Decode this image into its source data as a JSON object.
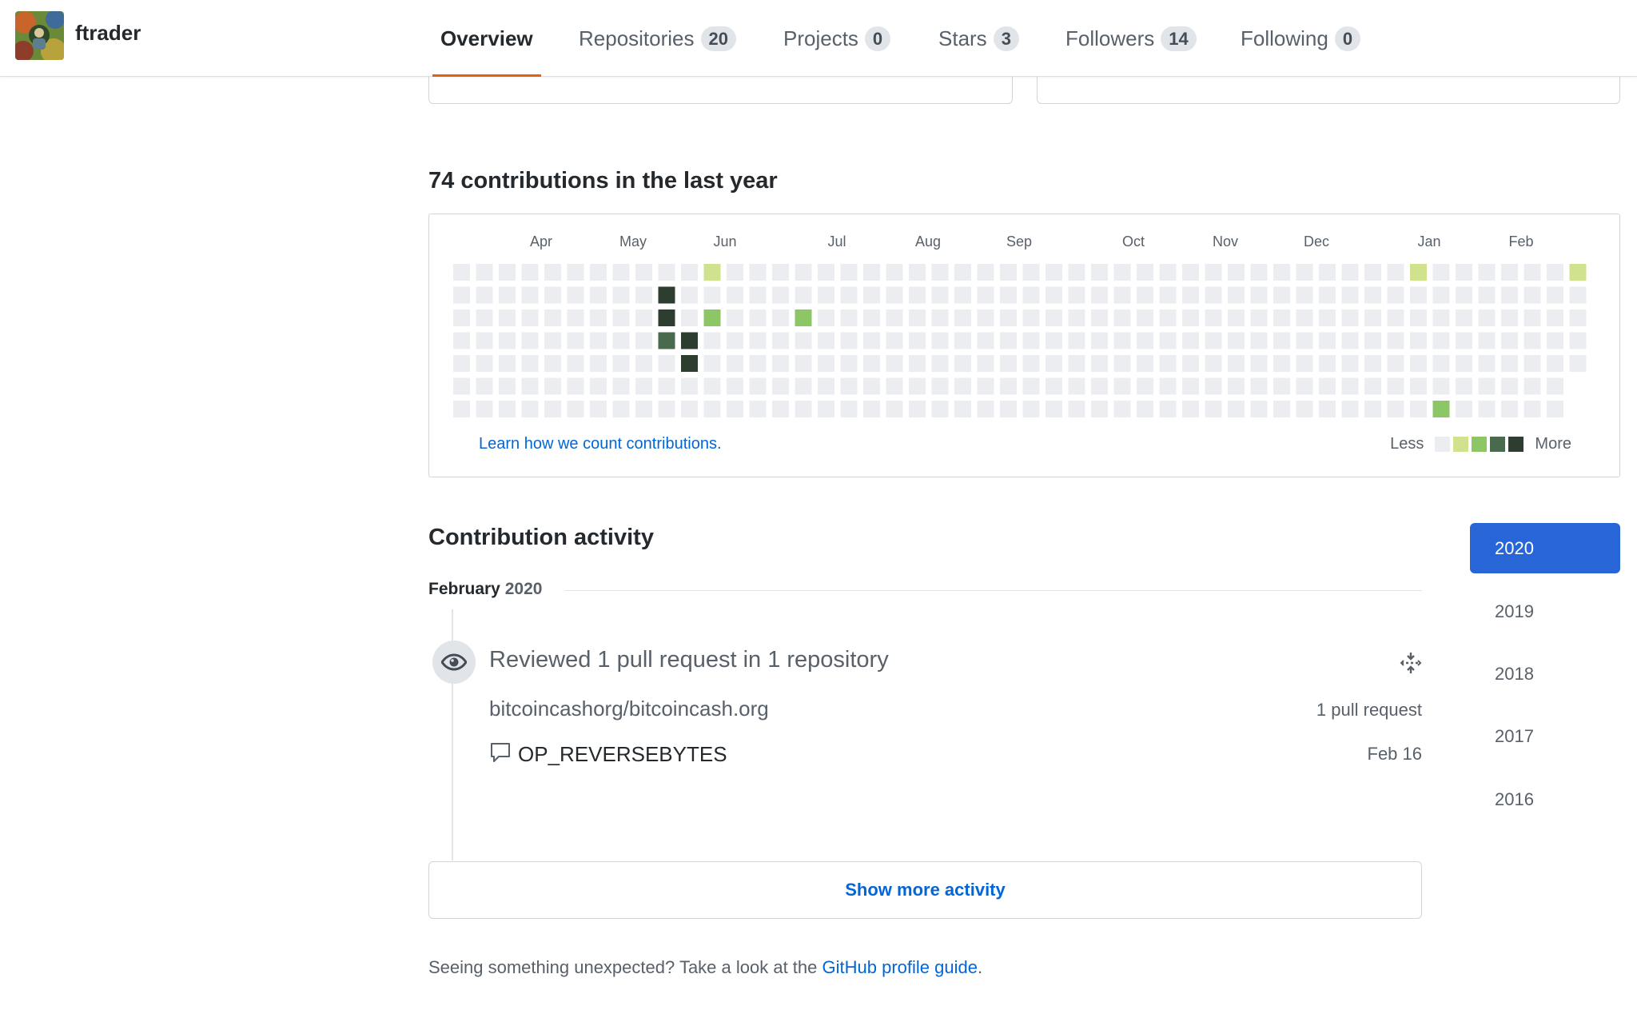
{
  "header": {
    "username": "ftrader",
    "tabs": [
      {
        "label": "Overview",
        "count": null,
        "active": true
      },
      {
        "label": "Repositories",
        "count": "20"
      },
      {
        "label": "Projects",
        "count": "0"
      },
      {
        "label": "Stars",
        "count": "3"
      },
      {
        "label": "Followers",
        "count": "14"
      },
      {
        "label": "Following",
        "count": "0"
      }
    ]
  },
  "contributions": {
    "heading": "74 contributions in the last year",
    "months": [
      "Apr",
      "May",
      "Jun",
      "Jul",
      "Aug",
      "Sep",
      "Oct",
      "Nov",
      "Dec",
      "Jan",
      "Feb"
    ],
    "learn_link": "Learn how we count contributions.",
    "legend_less": "Less",
    "legend_more": "More",
    "colors": {
      "level0": "#ebedf0",
      "level1": "#d1e28f",
      "level2": "#8cc665",
      "level3": "#4a6a4e",
      "level4": "#2d3d30"
    },
    "active_days": [
      {
        "week": 9,
        "day": 1,
        "level": 4
      },
      {
        "week": 9,
        "day": 2,
        "level": 4
      },
      {
        "week": 9,
        "day": 3,
        "level": 3
      },
      {
        "week": 10,
        "day": 3,
        "level": 4
      },
      {
        "week": 10,
        "day": 4,
        "level": 4
      },
      {
        "week": 11,
        "day": 0,
        "level": 1
      },
      {
        "week": 11,
        "day": 2,
        "level": 2
      },
      {
        "week": 15,
        "day": 2,
        "level": 2
      },
      {
        "week": 42,
        "day": 0,
        "level": 1
      },
      {
        "week": 43,
        "day": 6,
        "level": 2
      },
      {
        "week": 49,
        "day": 0,
        "level": 1
      }
    ]
  },
  "activity": {
    "heading": "Contribution activity",
    "month": "February",
    "year": "2020",
    "review_title": "Reviewed 1 pull request in 1 repository",
    "repo": "bitcoincashorg/bitcoincash.org",
    "pr_count": "1 pull request",
    "pr_title": "OP_REVERSEBYTES",
    "pr_date": "Feb 16",
    "show_more": "Show more activity"
  },
  "footer": {
    "text": "Seeing something unexpected? Take a look at the ",
    "link": "GitHub profile guide",
    "end": "."
  },
  "years": [
    "2020",
    "2019",
    "2018",
    "2017",
    "2016"
  ],
  "selected_year": "2020"
}
